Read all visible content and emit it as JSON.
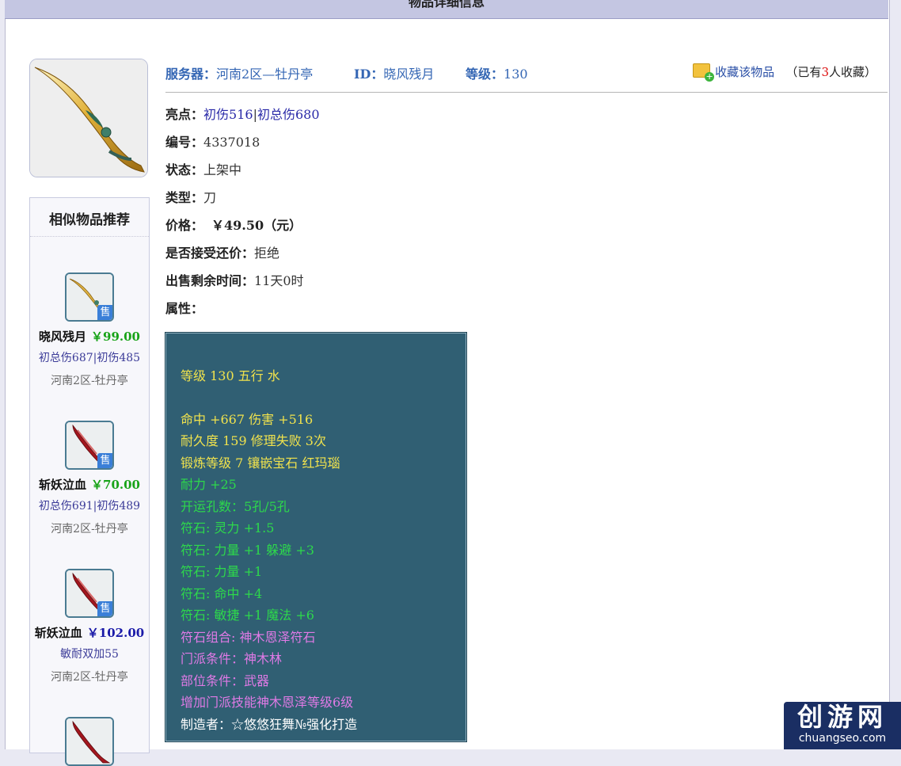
{
  "page": {
    "title": "物品详细信息"
  },
  "item": {
    "server_label": "服务器：",
    "server": "河南2区—牡丹亭",
    "id_label": "ID：",
    "id": "晓风残月",
    "level_label": "等级：",
    "level": "130",
    "favorite_link": "收藏该物品",
    "favorite_prefix": "（已有",
    "favorite_count": "3",
    "favorite_suffix": "人收藏）",
    "highlight_label": "亮点：",
    "highlight_1": "初伤516",
    "highlight_sep": "|",
    "highlight_2": "初总伤680",
    "number_label": "编号：",
    "number": "4337018",
    "status_label": "状态：",
    "status": "上架中",
    "type_label": "类型：",
    "type": "刀",
    "price_label": "价格：",
    "price": "￥49.50（元）",
    "counter_label": "是否接受还价：",
    "counter": "拒绝",
    "time_label": "出售剩余时间：",
    "time": "11天0时",
    "attr_label": "属性："
  },
  "attributes": [
    {
      "text": "等级 130 五行 水",
      "color": "yellow"
    },
    {
      "text": "命中 +667 伤害 +516",
      "color": "yellow"
    },
    {
      "text": "耐久度 159 修理失败 3次",
      "color": "yellow"
    },
    {
      "text": "锻炼等级 7 镶嵌宝石 红玛瑙",
      "color": "yellow"
    },
    {
      "text": "耐力 +25",
      "color": "green"
    },
    {
      "text": "开运孔数：5孔/5孔",
      "color": "green"
    },
    {
      "text": "符石: 灵力 +1.5",
      "color": "green"
    },
    {
      "text": "符石: 力量 +1 躲避 +3",
      "color": "green"
    },
    {
      "text": "符石: 力量 +1",
      "color": "green"
    },
    {
      "text": "符石: 命中 +4",
      "color": "green"
    },
    {
      "text": "符石: 敏捷 +1 魔法 +6",
      "color": "green"
    },
    {
      "text": "符石组合: 神木恩泽符石",
      "color": "purple"
    },
    {
      "text": "门派条件：神木林",
      "color": "purple"
    },
    {
      "text": "部位条件：武器",
      "color": "purple"
    },
    {
      "text": "增加门派技能神木恩泽等级6级",
      "color": "purple"
    },
    {
      "text": "制造者：☆悠悠狂舞№强化打造",
      "color": "white"
    }
  ],
  "sidebar": {
    "title": "相似物品推荐",
    "sale_badge": "售",
    "items": [
      {
        "name": "晓风残月",
        "price": "￥99.00",
        "attrs": "初总伤687|初伤485",
        "server": "河南2区-牡丹亭"
      },
      {
        "name": "斩妖泣血",
        "price": "￥70.00",
        "attrs": "初总伤691|初伤489",
        "server": "河南2区-牡丹亭"
      },
      {
        "name": "斩妖泣血",
        "price": "￥102.00",
        "attrs": "敏耐双加55",
        "server": "河南2区-牡丹亭"
      }
    ]
  },
  "watermark": {
    "title": "创游网",
    "url": "chuangseo.com"
  }
}
